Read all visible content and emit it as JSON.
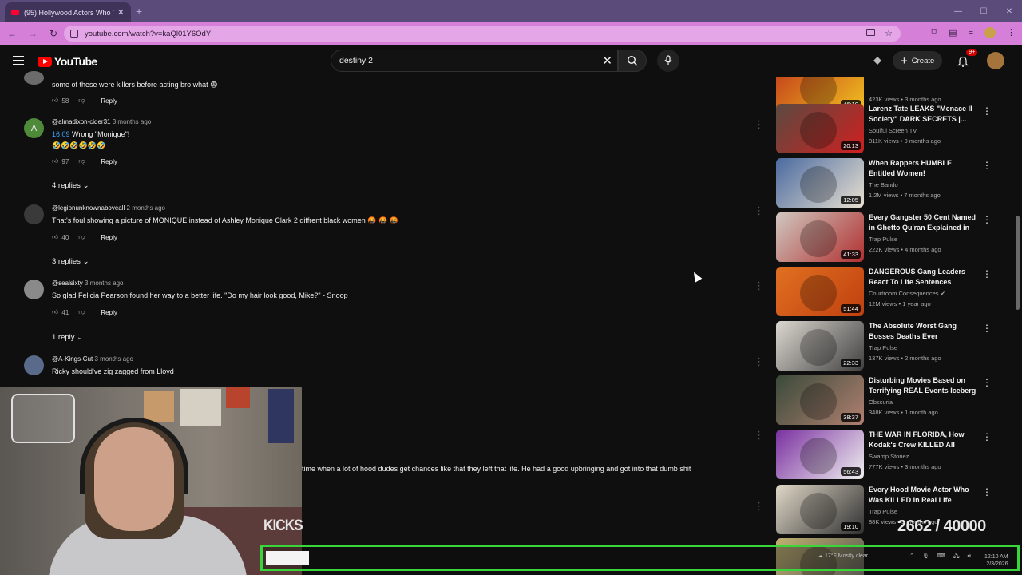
{
  "browser": {
    "tab_title": "(95) Hollywood Actors Who Tu",
    "url": "youtube.com/watch?v=kaQl01Y6OdY"
  },
  "youtube": {
    "logo_text": "YouTube",
    "search_value": "destiny 2",
    "create_label": "Create",
    "notif_badge": "9+"
  },
  "comments": [
    {
      "handle": "",
      "time": "",
      "text": "some of these were killers before acting bro what 😨",
      "likes": "58",
      "reply_label": "Reply"
    },
    {
      "handle": "@almadixon-cider31",
      "time": "3 months ago",
      "timestamp": "16:09",
      "text": " Wrong \"Monique\"!",
      "text2": "🤣🤣🤣🤣🤣🤣",
      "likes": "97",
      "reply_label": "Reply",
      "replies": "4 replies"
    },
    {
      "handle": "@legionunknownaboveall",
      "time": "2 months ago",
      "text": "That's foul showing a picture of MONIQUE instead of Ashley Monique Clark 2 diffrent black women 🤬 🤬 🤬",
      "likes": "40",
      "reply_label": "Reply",
      "replies": "3 replies"
    },
    {
      "handle": "@sealsixty",
      "time": "3 months ago",
      "text": "So glad Felicia Pearson found her way to a better life. \"Do my hair look good, Mike?\" - Snoop",
      "likes": "41",
      "reply_label": "Reply",
      "replies": "1 reply"
    },
    {
      "handle": "@A-Kings-Cut",
      "time": "3 months ago",
      "text": "Ricky should've zig zagged from Lloyd"
    }
  ],
  "partial_comment_text": "time when a lot of hood dudes get chances like that they left that life. He had a good upbringing and got into that dumb shit",
  "sidebar": [
    {
      "title": "",
      "channel": "",
      "meta": "423K views • 3 months ago",
      "duration": "46:10",
      "colors": [
        "#c23a1a",
        "#f0c020"
      ]
    },
    {
      "title": "Larenz Tate LEAKS \"Menace II Society\" DARK SECRETS |...",
      "channel": "Soulful Screen TV",
      "meta": "811K views • 9 months ago",
      "duration": "20:13",
      "colors": [
        "#5a4a40",
        "#d02020"
      ]
    },
    {
      "title": "When Rappers HUMBLE Entitled Women!",
      "channel": "The Bando",
      "meta": "1.2M views • 7 months ago",
      "duration": "12:05",
      "colors": [
        "#4a6aa0",
        "#e8e0d0"
      ]
    },
    {
      "title": "Every Gangster 50 Cent Named in Ghetto Qu'ran Explained in ...",
      "channel": "Trap Pulse",
      "meta": "222K views • 4 months ago",
      "duration": "41:33",
      "colors": [
        "#d0c8c0",
        "#b03030"
      ]
    },
    {
      "title": "DANGEROUS Gang Leaders React To Life Sentences",
      "channel": "Courtroom Consequences ✔",
      "meta": "12M views • 1 year ago",
      "duration": "51:44",
      "colors": [
        "#e07020",
        "#c04010"
      ]
    },
    {
      "title": "The Absolute Worst Gang Bosses Deaths Ever",
      "channel": "Trap Pulse",
      "meta": "137K views • 2 months ago",
      "duration": "22:33",
      "colors": [
        "#dcd8d0",
        "#404040"
      ]
    },
    {
      "title": "Disturbing Movies Based on Terrifying REAL Events Iceberg",
      "channel": "Obscuria",
      "meta": "348K views • 1 month ago",
      "duration": "38:37",
      "colors": [
        "#3a4a3a",
        "#b08070"
      ]
    },
    {
      "title": "THE WAR IN FLORIDA, How Kodak's Crew KILLED All Their...",
      "channel": "Swamp Storiez",
      "meta": "777K views • 3 months ago",
      "duration": "56:43",
      "colors": [
        "#7a30a0",
        "#f0f0f0"
      ]
    },
    {
      "title": "Every Hood Movie Actor Who Was KILLED In Real Life",
      "channel": "Trap Pulse",
      "meta": "88K views • 3 months ago",
      "duration": "19:10",
      "colors": [
        "#e0d8c8",
        "#303030"
      ]
    },
    {
      "title": "",
      "channel": "",
      "meta": "",
      "duration": "",
      "colors": [
        "#c0b070",
        "#505050"
      ]
    }
  ],
  "stream": {
    "kicks_label": "KICKS",
    "counter": "2662 / 40000",
    "weather_temp": "17°F",
    "weather_desc": "Mostly clear",
    "clock_time": "12:10 AM",
    "clock_date": "2/3/2026"
  }
}
